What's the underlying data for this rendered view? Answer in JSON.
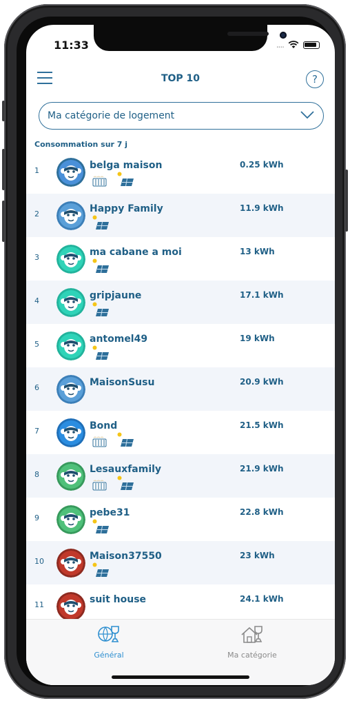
{
  "status": {
    "time": "11:33",
    "signal": "....",
    "wifi_icon": "wifi-icon",
    "battery_icon": "battery-icon"
  },
  "header": {
    "title": "TOP 10",
    "menu_icon": "hamburger-menu-icon",
    "help_icon": "question-circle-icon",
    "help_glyph": "?"
  },
  "category_select": {
    "value": "Ma catégorie de logement",
    "icon": "chevron-down-icon"
  },
  "subtitle": "Consommation sur 7 j",
  "rows": [
    {
      "rank": "1",
      "name": "belga maison",
      "kwh": "0.25 kWh",
      "avatar": "#4a90d9",
      "ring": "#2e6f9a",
      "radiator": true,
      "solar": true
    },
    {
      "rank": "2",
      "name": "Happy Family",
      "kwh": "11.9 kWh",
      "avatar": "#5a9fd8",
      "ring": "#3c7fb8",
      "radiator": false,
      "solar": true
    },
    {
      "rank": "3",
      "name": "ma cabane a moi",
      "kwh": "13 kWh",
      "avatar": "#2fd3b8",
      "ring": "#22b39c",
      "radiator": false,
      "solar": true
    },
    {
      "rank": "4",
      "name": "gripjaune",
      "kwh": "17.1 kWh",
      "avatar": "#2fd3b8",
      "ring": "#22b39c",
      "radiator": false,
      "solar": true
    },
    {
      "rank": "5",
      "name": "antomel49",
      "kwh": "19 kWh",
      "avatar": "#2fd3b8",
      "ring": "#22b39c",
      "radiator": false,
      "solar": true
    },
    {
      "rank": "6",
      "name": "MaisonSusu",
      "kwh": "20.9 kWh",
      "avatar": "#5a9fd8",
      "ring": "#3c7fb8",
      "radiator": false,
      "solar": false
    },
    {
      "rank": "7",
      "name": "Bond",
      "kwh": "21.5 kWh",
      "avatar": "#2b8de0",
      "ring": "#1f6fb8",
      "radiator": true,
      "solar": true
    },
    {
      "rank": "8",
      "name": "Lesauxfamily",
      "kwh": "21.9 kWh",
      "avatar": "#4fc07a",
      "ring": "#379a5c",
      "radiator": true,
      "solar": true
    },
    {
      "rank": "9",
      "name": "pebe31",
      "kwh": "22.8 kWh",
      "avatar": "#4fc07a",
      "ring": "#379a5c",
      "radiator": false,
      "solar": true
    },
    {
      "rank": "10",
      "name": "Maison37550",
      "kwh": "23 kWh",
      "avatar": "#c0392b",
      "ring": "#8e2a20",
      "radiator": false,
      "solar": true
    },
    {
      "rank": "11",
      "name": "suit house",
      "kwh": "24.1 kWh",
      "avatar": "#c0392b",
      "ring": "#8e2a20",
      "radiator": false,
      "solar": false
    }
  ],
  "tabs": [
    {
      "label": "Général",
      "icon": "globe-trophy-icon",
      "active": true
    },
    {
      "label": "Ma catégorie",
      "icon": "house-trophy-icon",
      "active": false
    }
  ],
  "colors": {
    "primary": "#1f5f86",
    "active_tab": "#2e8fd0",
    "inactive_tab": "#8a8a8a",
    "row_alt": "#f2f5fa"
  }
}
